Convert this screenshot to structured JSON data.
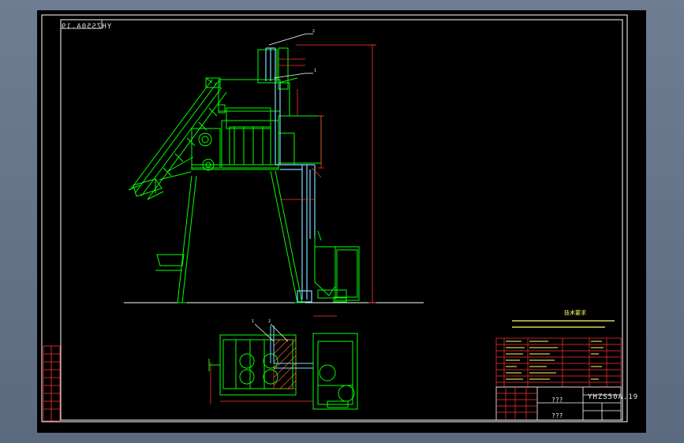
{
  "drawing_number": "YHZS50A.19",
  "title_block": {
    "drawing_number": "YHZS50A.19",
    "name_1": "???",
    "name_2": "???"
  },
  "technical_requirements": {
    "title": "技术要求"
  },
  "balloons": {
    "top_1": "2",
    "top_2": "1",
    "plan_1": "1",
    "plan_2": "2"
  },
  "colors": {
    "background": "#000000",
    "machine_outline": "#00ff00",
    "ducting": "#7fd8ff",
    "dimension": "#ff3333",
    "frame": "#ffffff",
    "notes": "#ffff66"
  }
}
